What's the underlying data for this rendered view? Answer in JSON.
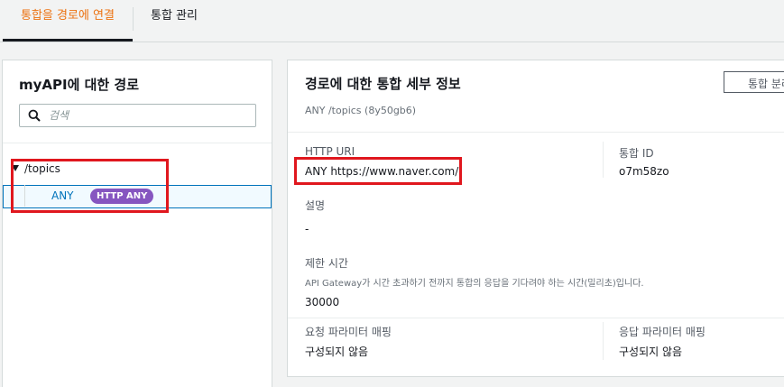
{
  "tabs": {
    "active": "통합을 경로에 연결",
    "inactive": "통합 관리"
  },
  "left_panel": {
    "title": "myAPI에 대한 경로",
    "search_placeholder": "검색",
    "tree": {
      "resource": "/topics",
      "method": "ANY",
      "badge": "HTTP ANY"
    }
  },
  "details": {
    "title": "경로에 대한 통합 세부 정보",
    "subtitle": "ANY /topics (8y50gb6)",
    "detach_button": "통합 분리",
    "http_uri_label": "HTTP URI",
    "http_uri_value": "ANY https://www.naver.com/",
    "integration_id_label": "통합 ID",
    "integration_id_value": "o7m58zo",
    "description_label": "설명",
    "description_value": "-",
    "timeout_label": "제한 시간",
    "timeout_hint": "API Gateway가 시간 초과하기 전까지 통합의 응답을 기다려야 하는 시간(밀리초)입니다.",
    "timeout_value": "30000",
    "request_params_label": "요청 파라미터 매핑",
    "request_params_value": "구성되지 않음",
    "response_params_label": "응답 파라미터 매핑",
    "response_params_value": "구성되지 않음"
  },
  "colors": {
    "accent": "#ec7211",
    "link": "#0073bb",
    "badge": "#8656c0",
    "highlight": "#e0171e"
  }
}
